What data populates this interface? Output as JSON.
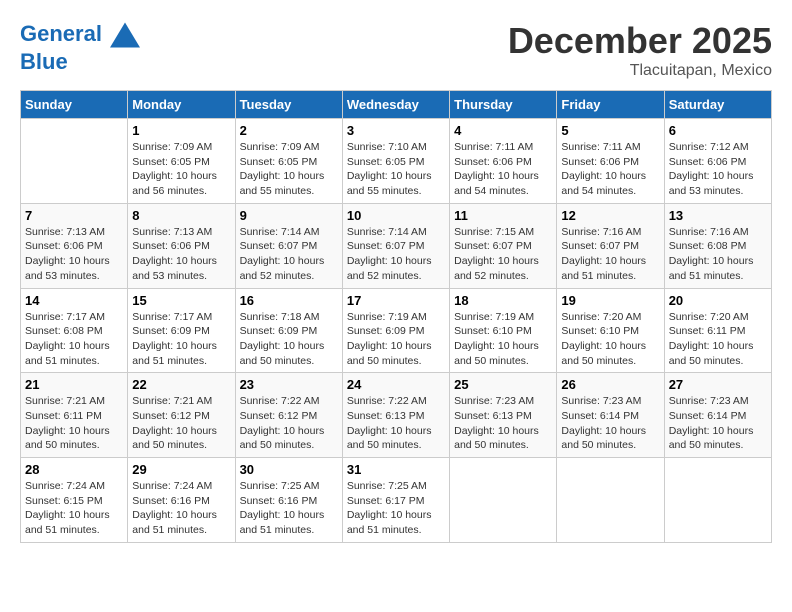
{
  "header": {
    "logo_line1": "General",
    "logo_line2": "Blue",
    "month": "December 2025",
    "location": "Tlacuitapan, Mexico"
  },
  "days_of_week": [
    "Sunday",
    "Monday",
    "Tuesday",
    "Wednesday",
    "Thursday",
    "Friday",
    "Saturday"
  ],
  "weeks": [
    [
      {
        "day": "",
        "text": ""
      },
      {
        "day": "1",
        "text": "Sunrise: 7:09 AM\nSunset: 6:05 PM\nDaylight: 10 hours\nand 56 minutes."
      },
      {
        "day": "2",
        "text": "Sunrise: 7:09 AM\nSunset: 6:05 PM\nDaylight: 10 hours\nand 55 minutes."
      },
      {
        "day": "3",
        "text": "Sunrise: 7:10 AM\nSunset: 6:05 PM\nDaylight: 10 hours\nand 55 minutes."
      },
      {
        "day": "4",
        "text": "Sunrise: 7:11 AM\nSunset: 6:06 PM\nDaylight: 10 hours\nand 54 minutes."
      },
      {
        "day": "5",
        "text": "Sunrise: 7:11 AM\nSunset: 6:06 PM\nDaylight: 10 hours\nand 54 minutes."
      },
      {
        "day": "6",
        "text": "Sunrise: 7:12 AM\nSunset: 6:06 PM\nDaylight: 10 hours\nand 53 minutes."
      }
    ],
    [
      {
        "day": "7",
        "text": "Sunrise: 7:13 AM\nSunset: 6:06 PM\nDaylight: 10 hours\nand 53 minutes."
      },
      {
        "day": "8",
        "text": "Sunrise: 7:13 AM\nSunset: 6:06 PM\nDaylight: 10 hours\nand 53 minutes."
      },
      {
        "day": "9",
        "text": "Sunrise: 7:14 AM\nSunset: 6:07 PM\nDaylight: 10 hours\nand 52 minutes."
      },
      {
        "day": "10",
        "text": "Sunrise: 7:14 AM\nSunset: 6:07 PM\nDaylight: 10 hours\nand 52 minutes."
      },
      {
        "day": "11",
        "text": "Sunrise: 7:15 AM\nSunset: 6:07 PM\nDaylight: 10 hours\nand 52 minutes."
      },
      {
        "day": "12",
        "text": "Sunrise: 7:16 AM\nSunset: 6:07 PM\nDaylight: 10 hours\nand 51 minutes."
      },
      {
        "day": "13",
        "text": "Sunrise: 7:16 AM\nSunset: 6:08 PM\nDaylight: 10 hours\nand 51 minutes."
      }
    ],
    [
      {
        "day": "14",
        "text": "Sunrise: 7:17 AM\nSunset: 6:08 PM\nDaylight: 10 hours\nand 51 minutes."
      },
      {
        "day": "15",
        "text": "Sunrise: 7:17 AM\nSunset: 6:09 PM\nDaylight: 10 hours\nand 51 minutes."
      },
      {
        "day": "16",
        "text": "Sunrise: 7:18 AM\nSunset: 6:09 PM\nDaylight: 10 hours\nand 50 minutes."
      },
      {
        "day": "17",
        "text": "Sunrise: 7:19 AM\nSunset: 6:09 PM\nDaylight: 10 hours\nand 50 minutes."
      },
      {
        "day": "18",
        "text": "Sunrise: 7:19 AM\nSunset: 6:10 PM\nDaylight: 10 hours\nand 50 minutes."
      },
      {
        "day": "19",
        "text": "Sunrise: 7:20 AM\nSunset: 6:10 PM\nDaylight: 10 hours\nand 50 minutes."
      },
      {
        "day": "20",
        "text": "Sunrise: 7:20 AM\nSunset: 6:11 PM\nDaylight: 10 hours\nand 50 minutes."
      }
    ],
    [
      {
        "day": "21",
        "text": "Sunrise: 7:21 AM\nSunset: 6:11 PM\nDaylight: 10 hours\nand 50 minutes."
      },
      {
        "day": "22",
        "text": "Sunrise: 7:21 AM\nSunset: 6:12 PM\nDaylight: 10 hours\nand 50 minutes."
      },
      {
        "day": "23",
        "text": "Sunrise: 7:22 AM\nSunset: 6:12 PM\nDaylight: 10 hours\nand 50 minutes."
      },
      {
        "day": "24",
        "text": "Sunrise: 7:22 AM\nSunset: 6:13 PM\nDaylight: 10 hours\nand 50 minutes."
      },
      {
        "day": "25",
        "text": "Sunrise: 7:23 AM\nSunset: 6:13 PM\nDaylight: 10 hours\nand 50 minutes."
      },
      {
        "day": "26",
        "text": "Sunrise: 7:23 AM\nSunset: 6:14 PM\nDaylight: 10 hours\nand 50 minutes."
      },
      {
        "day": "27",
        "text": "Sunrise: 7:23 AM\nSunset: 6:14 PM\nDaylight: 10 hours\nand 50 minutes."
      }
    ],
    [
      {
        "day": "28",
        "text": "Sunrise: 7:24 AM\nSunset: 6:15 PM\nDaylight: 10 hours\nand 51 minutes."
      },
      {
        "day": "29",
        "text": "Sunrise: 7:24 AM\nSunset: 6:16 PM\nDaylight: 10 hours\nand 51 minutes."
      },
      {
        "day": "30",
        "text": "Sunrise: 7:25 AM\nSunset: 6:16 PM\nDaylight: 10 hours\nand 51 minutes."
      },
      {
        "day": "31",
        "text": "Sunrise: 7:25 AM\nSunset: 6:17 PM\nDaylight: 10 hours\nand 51 minutes."
      },
      {
        "day": "",
        "text": ""
      },
      {
        "day": "",
        "text": ""
      },
      {
        "day": "",
        "text": ""
      }
    ]
  ]
}
